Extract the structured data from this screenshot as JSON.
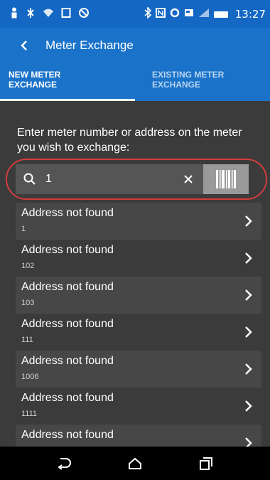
{
  "status_bar": {
    "time": "13:27"
  },
  "app_bar": {
    "title": "Meter Exchange"
  },
  "tabs": [
    {
      "line1": "NEW METER",
      "line2": "EXCHANGE"
    },
    {
      "line1": "EXISTING METER",
      "line2": "EXCHANGE"
    }
  ],
  "main": {
    "prompt": "Enter meter number or address on the meter you wish to exchange:",
    "search": {
      "value": "1",
      "placeholder": ""
    },
    "results": [
      {
        "title": "Address not found",
        "number": "1"
      },
      {
        "title": "Address not found",
        "number": "102"
      },
      {
        "title": "Address not found",
        "number": "103"
      },
      {
        "title": "Address not found",
        "number": "111"
      },
      {
        "title": "Address not found",
        "number": "1006"
      },
      {
        "title": "Address not found",
        "number": "1111"
      },
      {
        "title": "Address not found",
        "number": ""
      }
    ]
  },
  "colors": {
    "primary": "#1a73c9",
    "background": "#3b3b3b",
    "highlight": "#d23c3c"
  },
  "icons": {
    "status": [
      "person-icon",
      "bluetooth-icon",
      "wifi-icon",
      "nfc-icon",
      "signal-icon",
      "battery-icon"
    ],
    "nav": [
      "back-nav-icon",
      "home-nav-icon",
      "recents-nav-icon"
    ]
  }
}
